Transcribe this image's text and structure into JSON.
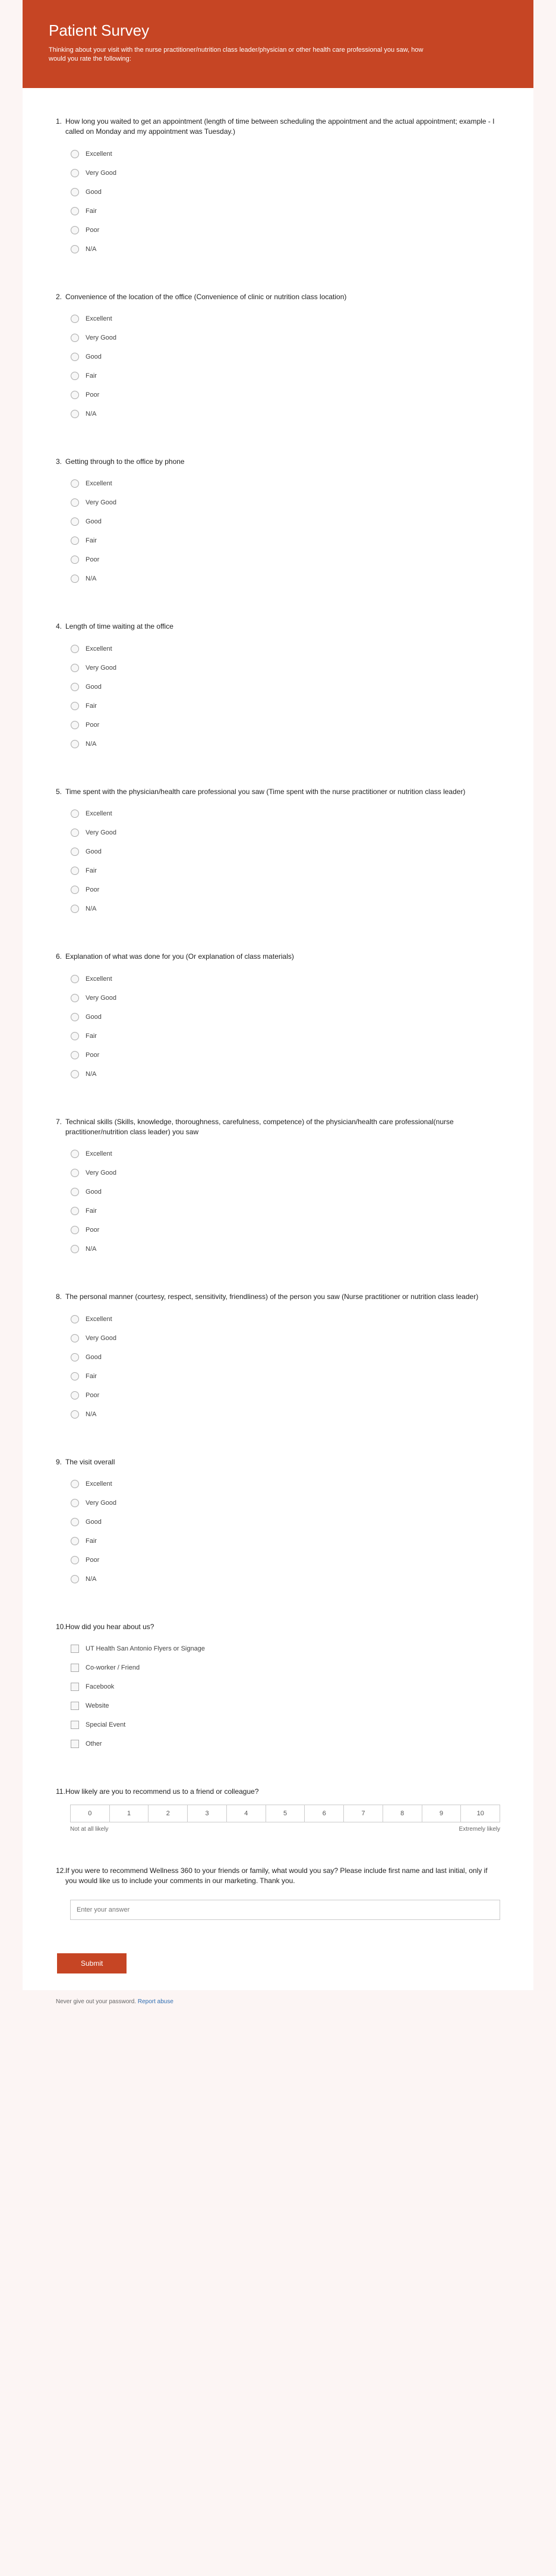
{
  "header": {
    "title": "Patient Survey",
    "subtitle": "Thinking about your visit with the nurse practitioner/nutrition class leader/physician or other health care professional you saw, how would you rate the following:"
  },
  "rating_options": [
    "Excellent",
    "Very Good",
    "Good",
    "Fair",
    "Poor",
    "N/A"
  ],
  "questions": [
    {
      "num": "1.",
      "text": "How long you waited to get an appointment (length of time between scheduling the appointment and the actual appointment; example - I called on Monday and my appointment was Tuesday.)",
      "type": "radio"
    },
    {
      "num": "2.",
      "text": "Convenience of the location of the office (Convenience of clinic or nutrition class location)",
      "type": "radio"
    },
    {
      "num": "3.",
      "text": "Getting through to the office by phone",
      "type": "radio"
    },
    {
      "num": "4.",
      "text": "Length of time waiting at the office",
      "type": "radio"
    },
    {
      "num": "5.",
      "text": "Time spent with the physician/health care professional you saw (Time spent with the nurse practitioner or nutrition class leader)",
      "type": "radio"
    },
    {
      "num": "6.",
      "text": "Explanation of what was done for you (Or explanation of class materials)",
      "type": "radio"
    },
    {
      "num": "7.",
      "text": "Technical skills (Skills, knowledge, thoroughness, carefulness, competence) of the physician/health care professional(nurse practitioner/nutrition class leader) you saw",
      "type": "radio"
    },
    {
      "num": "8.",
      "text": "The personal manner (courtesy, respect, sensitivity, friendliness) of the person you saw (Nurse practitioner or nutrition class leader)",
      "type": "radio"
    },
    {
      "num": "9.",
      "text": "The visit overall",
      "type": "radio"
    }
  ],
  "q10": {
    "num": "10.",
    "text": "How did you hear about us?",
    "options": [
      "UT Health San Antonio Flyers or Signage",
      "Co-worker / Friend",
      "Facebook",
      "Website",
      "Special Event",
      "Other"
    ]
  },
  "q11": {
    "num": "11.",
    "text": "How likely are you to recommend us to a friend or colleague?",
    "scale": [
      "0",
      "1",
      "2",
      "3",
      "4",
      "5",
      "6",
      "7",
      "8",
      "9",
      "10"
    ],
    "left": "Not at all likely",
    "right": "Extremely likely"
  },
  "q12": {
    "num": "12.",
    "text": "If you were to recommend Wellness 360 to your friends or family, what would you say? Please include first name and last initial, only if you would like us to include your comments in our marketing. Thank you.",
    "placeholder": "Enter your answer"
  },
  "submit_label": "Submit",
  "footer": {
    "prefix": "Never give out your password. ",
    "link": "Report abuse"
  }
}
